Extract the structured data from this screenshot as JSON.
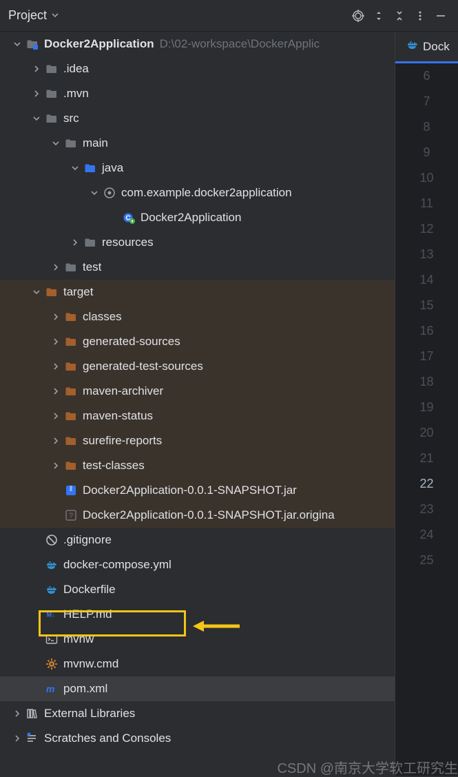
{
  "header": {
    "title": "Project"
  },
  "editor_tab": {
    "label": "Dock"
  },
  "gutter": {
    "start": 6,
    "end": 25,
    "current": 22
  },
  "tree": {
    "root": {
      "name": "Docker2Application",
      "path": "D:\\02-workspace\\DockerApplic"
    },
    "idea": ".idea",
    "mvn": ".mvn",
    "src": "src",
    "main": "main",
    "java": "java",
    "pkg": "com.example.docker2application",
    "appclass": "Docker2Application",
    "resources": "resources",
    "test": "test",
    "target": "target",
    "classes": "classes",
    "gensources": "generated-sources",
    "gentestsources": "generated-test-sources",
    "mavenarchiver": "maven-archiver",
    "mavenstatus": "maven-status",
    "surefire": "surefire-reports",
    "testclasses": "test-classes",
    "jar": "Docker2Application-0.0.1-SNAPSHOT.jar",
    "jarorig": "Docker2Application-0.0.1-SNAPSHOT.jar.origina",
    "gitignore": ".gitignore",
    "compose": "docker-compose.yml",
    "dockerfile": "Dockerfile",
    "help": "HELP.md",
    "mvnw": "mvnw",
    "mvnwcmd": "mvnw.cmd",
    "pom": "pom.xml",
    "extlib": "External Libraries",
    "scratches": "Scratches and Consoles"
  },
  "watermark": "CSDN @南京大学软工研究生"
}
